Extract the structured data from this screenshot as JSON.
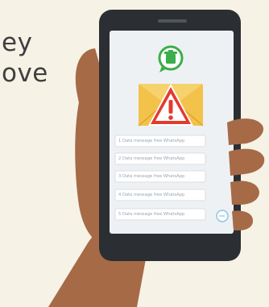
{
  "background_text": {
    "line1": "ey",
    "line2": "ove"
  },
  "messages": [
    "1 Data message free WhatsApp",
    "2 Data message free WhatsApp",
    "3 Data message free WhatsApp",
    "4 Data message free WhatsApp",
    "5 Data message free WhatsApp"
  ],
  "icons": {
    "app": "chat-bubble-trash-icon",
    "alert": "envelope-warning-icon",
    "reply": "reply-bubble-icon"
  },
  "colors": {
    "background": "#f6f2e6",
    "skin": "#a66a47",
    "phone": "#2b2f33",
    "screen": "#eef1f3",
    "envelope": "#f2c24a",
    "warning": "#e23b30",
    "app_green": "#3cae4b"
  }
}
